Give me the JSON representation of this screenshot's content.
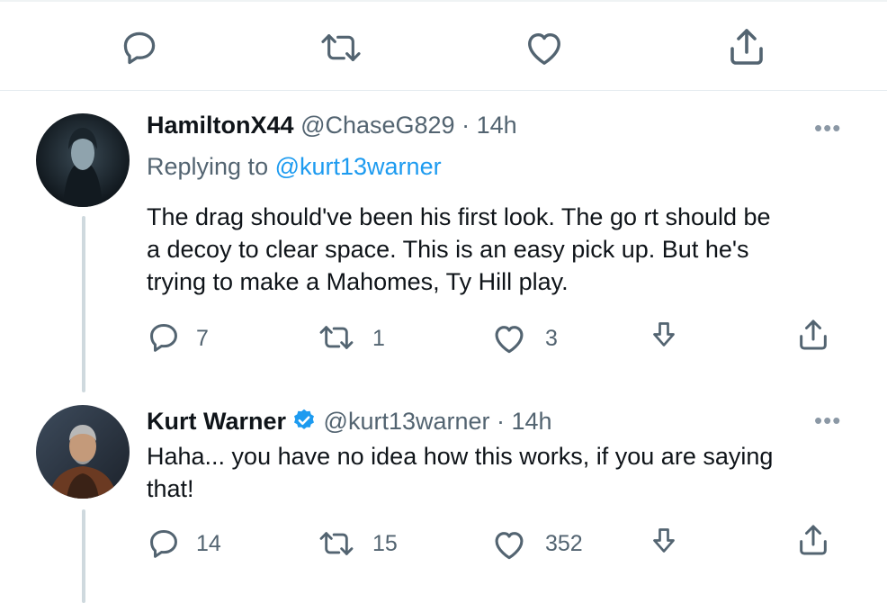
{
  "top_actions": {
    "reply": {
      "icon": "comment-icon"
    },
    "retweet": {
      "icon": "retweet-icon"
    },
    "like": {
      "icon": "heart-icon"
    },
    "share": {
      "icon": "share-icon"
    }
  },
  "tweets": [
    {
      "display_name": "HamiltonX44",
      "handle": "@ChaseG829",
      "time": "· 14h",
      "replying_label": "Replying to ",
      "replying_to": "@kurt13warner",
      "body_lines": [
        "The drag should've been his first look. The go rt should be",
        "a decoy to clear space. This is an easy pick up. But he's",
        "trying to make a Mahomes, Ty Hill play."
      ],
      "more": "•••",
      "reply_count": "7",
      "retweet_count": "1",
      "like_count": "3"
    },
    {
      "display_name": "Kurt Warner",
      "verified": true,
      "handle": "@kurt13warner",
      "time": "· 14h",
      "body_lines": [
        "Haha... you have no idea how this works, if you are saying",
        "that!"
      ],
      "more": "•••",
      "reply_count": "14",
      "retweet_count": "15",
      "like_count": "352"
    }
  ],
  "colors": {
    "accent": "#1d9bf0",
    "text": "#0f1419",
    "secondary": "#536471",
    "divider": "#e6ecf0",
    "thread_line": "#cfd9de"
  }
}
